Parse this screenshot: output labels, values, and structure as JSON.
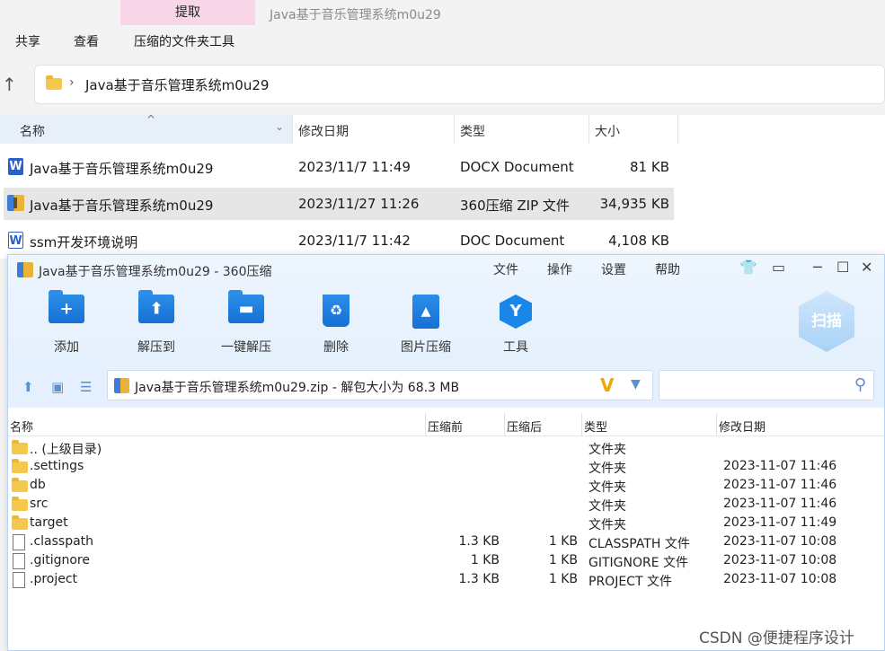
{
  "explorer": {
    "context_tab": "提取",
    "context_title": "Java基于音乐管理系统m0u29",
    "ribbon_tabs": [
      "共享",
      "查看",
      "压缩的文件夹工具"
    ],
    "address": "Java基于音乐管理系统m0u29",
    "columns": [
      "名称",
      "修改日期",
      "类型",
      "大小"
    ],
    "files": [
      {
        "name": "Java基于音乐管理系统m0u29",
        "date": "2023/11/7 11:49",
        "type": "DOCX Document",
        "size": "81 KB",
        "icon": "word-icon"
      },
      {
        "name": "Java基于音乐管理系统m0u29",
        "date": "2023/11/27 11:26",
        "type": "360压缩 ZIP 文件",
        "size": "34,935 KB",
        "icon": "zip-icon"
      },
      {
        "name": "ssm开发环境说明",
        "date": "2023/11/7 11:42",
        "type": "DOC Document",
        "size": "4,108 KB",
        "icon": "doc-icon"
      }
    ]
  },
  "zip": {
    "title": "Java基于音乐管理系统m0u29 - 360压缩",
    "menu": [
      "文件",
      "操作",
      "设置",
      "帮助"
    ],
    "tools": [
      "添加",
      "解压到",
      "一键解压",
      "删除",
      "图片压缩",
      "工具"
    ],
    "scan_label": "扫描",
    "address": "Java基于音乐管理系统m0u29.zip - 解包大小为 68.3 MB",
    "columns": [
      "名称",
      "压缩前",
      "压缩后",
      "类型",
      "修改日期"
    ],
    "rows": [
      {
        "name": ".. (上级目录)",
        "before": "",
        "after": "",
        "type": "文件夹",
        "date": "",
        "kind": "folder"
      },
      {
        "name": ".settings",
        "before": "",
        "after": "",
        "type": "文件夹",
        "date": "2023-11-07 11:46",
        "kind": "folder"
      },
      {
        "name": "db",
        "before": "",
        "after": "",
        "type": "文件夹",
        "date": "2023-11-07 11:46",
        "kind": "folder"
      },
      {
        "name": "src",
        "before": "",
        "after": "",
        "type": "文件夹",
        "date": "2023-11-07 11:46",
        "kind": "folder"
      },
      {
        "name": "target",
        "before": "",
        "after": "",
        "type": "文件夹",
        "date": "2023-11-07 11:49",
        "kind": "folder"
      },
      {
        "name": ".classpath",
        "before": "1.3 KB",
        "after": "1 KB",
        "type": "CLASSPATH 文件",
        "date": "2023-11-07 10:08",
        "kind": "file"
      },
      {
        "name": ".gitignore",
        "before": "1 KB",
        "after": "1 KB",
        "type": "GITIGNORE 文件",
        "date": "2023-11-07 10:08",
        "kind": "file"
      },
      {
        "name": ".project",
        "before": "1.3 KB",
        "after": "1 KB",
        "type": "PROJECT 文件",
        "date": "2023-11-07 10:08",
        "kind": "file"
      }
    ]
  },
  "watermark": "CSDN @便捷程序设计",
  "colors": {
    "accent": "#1a86e8",
    "selection": "#e6e6e6",
    "context_tab": "#f8d6e7"
  }
}
